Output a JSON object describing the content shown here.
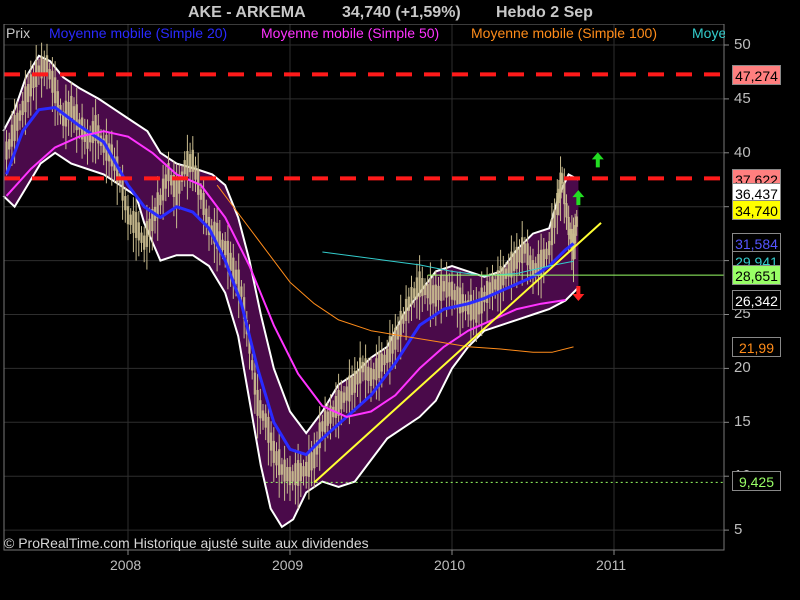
{
  "header": {
    "symbol": "AKE - ARKEMA",
    "price_change": "34,740 (+1,59%)",
    "period": "Hebdo  2 Sep"
  },
  "legend": {
    "items": [
      {
        "label": "Prix",
        "color": "#c8c8c8"
      },
      {
        "label": "Moyenne mobile (Simple 20)",
        "color": "#2a2aff"
      },
      {
        "label": "Moyenne mobile (Simple 50)",
        "color": "#ff33ff"
      },
      {
        "label": "Moyenne mobile (Simple 100)",
        "color": "#ff8c1a"
      },
      {
        "label": "Moye",
        "color": "#33cccc"
      }
    ]
  },
  "copyright": "© ProRealTime.com Historique ajusté suite aux dividendes",
  "axes": {
    "y_ticks": [
      "50",
      "45",
      "40",
      "35",
      "30",
      "25",
      "20",
      "15",
      "10",
      "5"
    ],
    "x_ticks": [
      "2008",
      "2009",
      "2010",
      "2011"
    ]
  },
  "price_tags": [
    {
      "label": "47,274",
      "bg": "#ff7f7f",
      "fg": "#000000",
      "value": 47.274
    },
    {
      "label": "37,622",
      "bg": "#ff7f7f",
      "fg": "#000000",
      "value": 37.622
    },
    {
      "label": "36,437",
      "bg": "#ffffff",
      "fg": "#000000",
      "value": 36.437
    },
    {
      "label": "34,740",
      "bg": "#ffff00",
      "fg": "#000000",
      "value": 34.74
    },
    {
      "label": "31,584",
      "bg": "#000000",
      "fg": "#5555ff",
      "value": 31.584
    },
    {
      "label": "29,941",
      "bg": "#000000",
      "fg": "#33cccc",
      "value": 29.941
    },
    {
      "label": "28,651",
      "bg": "#99ff66",
      "fg": "#000000",
      "value": 28.651
    },
    {
      "label": "26,342",
      "bg": "#000000",
      "fg": "#ffffff",
      "value": 26.342
    },
    {
      "label": "21,99",
      "bg": "#000000",
      "fg": "#ff8c1a",
      "value": 21.99
    },
    {
      "label": "9,425",
      "bg": "#000000",
      "fg": "#99ff66",
      "value": 9.425
    }
  ],
  "colors": {
    "background": "#000000",
    "band_fill": "#4a0a4a",
    "band_edge": "#ffffff",
    "candles": "#c9bc8f",
    "ma20": "#2a2aff",
    "ma50": "#ff33ff",
    "ma100": "#ff8c1a",
    "ma200": "#33cccc",
    "resistance": "#ff1a1a",
    "trendline": "#ffff33",
    "support_green": "#99ff66",
    "arrow_up": "#22dd22",
    "arrow_down": "#ff2222"
  },
  "chart_data": {
    "type": "line",
    "title": "AKE - ARKEMA",
    "ylim": [
      4,
      51
    ],
    "xlim": [
      2007.23,
      2011.62
    ],
    "y_ticks": [
      5,
      10,
      15,
      20,
      25,
      30,
      35,
      40,
      45,
      50
    ],
    "x_ticks": [
      2008,
      2009,
      2010,
      2011
    ],
    "grid": true,
    "series": [
      {
        "name": "Prix",
        "style": "candles",
        "points": [
          [
            2007.25,
            40
          ],
          [
            2007.3,
            42
          ],
          [
            2007.35,
            44
          ],
          [
            2007.4,
            46
          ],
          [
            2007.45,
            47.5
          ],
          [
            2007.5,
            48
          ],
          [
            2007.55,
            45.5
          ],
          [
            2007.6,
            43
          ],
          [
            2007.65,
            44
          ],
          [
            2007.7,
            42.5
          ],
          [
            2007.75,
            41
          ],
          [
            2007.8,
            42
          ],
          [
            2007.85,
            40.5
          ],
          [
            2007.9,
            39.5
          ],
          [
            2007.95,
            37.5
          ],
          [
            2008.0,
            34
          ],
          [
            2008.05,
            33
          ],
          [
            2008.1,
            31.5
          ],
          [
            2008.15,
            33.5
          ],
          [
            2008.2,
            35.5
          ],
          [
            2008.25,
            38
          ],
          [
            2008.3,
            36
          ],
          [
            2008.35,
            38.5
          ],
          [
            2008.4,
            39
          ],
          [
            2008.45,
            36
          ],
          [
            2008.5,
            33
          ],
          [
            2008.55,
            32
          ],
          [
            2008.6,
            31
          ],
          [
            2008.65,
            29
          ],
          [
            2008.7,
            27
          ],
          [
            2008.75,
            22
          ],
          [
            2008.8,
            16.5
          ],
          [
            2008.85,
            15
          ],
          [
            2008.9,
            12
          ],
          [
            2008.95,
            10.5
          ],
          [
            2009.0,
            9.8
          ],
          [
            2009.05,
            10
          ],
          [
            2009.1,
            10.5
          ],
          [
            2009.15,
            11.5
          ],
          [
            2009.2,
            14.5
          ],
          [
            2009.25,
            15.5
          ],
          [
            2009.3,
            16.5
          ],
          [
            2009.35,
            17.5
          ],
          [
            2009.4,
            18.5
          ],
          [
            2009.45,
            20
          ],
          [
            2009.5,
            19
          ],
          [
            2009.55,
            20
          ],
          [
            2009.6,
            21
          ],
          [
            2009.65,
            22.5
          ],
          [
            2009.7,
            24.5
          ],
          [
            2009.75,
            26.5
          ],
          [
            2009.8,
            27.5
          ],
          [
            2009.85,
            27
          ],
          [
            2009.9,
            26.5
          ],
          [
            2009.95,
            27.5
          ],
          [
            2010.0,
            27
          ],
          [
            2010.05,
            26
          ],
          [
            2010.1,
            25.5
          ],
          [
            2010.15,
            25
          ],
          [
            2010.2,
            26.5
          ],
          [
            2010.25,
            27.5
          ],
          [
            2010.3,
            28
          ],
          [
            2010.35,
            29
          ],
          [
            2010.4,
            30
          ],
          [
            2010.45,
            31
          ],
          [
            2010.5,
            29
          ],
          [
            2010.55,
            29.5
          ],
          [
            2010.6,
            31
          ],
          [
            2010.65,
            35
          ],
          [
            2010.68,
            37.5
          ],
          [
            2010.72,
            33
          ],
          [
            2010.75,
            31
          ],
          [
            2010.78,
            34.74
          ]
        ]
      },
      {
        "name": "Moyenne mobile (Simple 20)",
        "points": [
          [
            2007.25,
            38
          ],
          [
            2007.35,
            42
          ],
          [
            2007.45,
            44
          ],
          [
            2007.55,
            44.2
          ],
          [
            2007.7,
            42.5
          ],
          [
            2007.85,
            41
          ],
          [
            2008.0,
            37
          ],
          [
            2008.1,
            35
          ],
          [
            2008.2,
            34
          ],
          [
            2008.3,
            35
          ],
          [
            2008.4,
            34.5
          ],
          [
            2008.5,
            33
          ],
          [
            2008.6,
            30
          ],
          [
            2008.7,
            26
          ],
          [
            2008.8,
            20
          ],
          [
            2008.9,
            15
          ],
          [
            2009.0,
            12.5
          ],
          [
            2009.1,
            12
          ],
          [
            2009.2,
            13.5
          ],
          [
            2009.35,
            15.5
          ],
          [
            2009.5,
            17.5
          ],
          [
            2009.65,
            20.5
          ],
          [
            2009.8,
            24
          ],
          [
            2009.95,
            25.5
          ],
          [
            2010.1,
            26
          ],
          [
            2010.2,
            26.5
          ],
          [
            2010.35,
            27.5
          ],
          [
            2010.5,
            28.5
          ],
          [
            2010.6,
            29.5
          ],
          [
            2010.7,
            31
          ],
          [
            2010.75,
            31.584
          ]
        ]
      },
      {
        "name": "Moyenne mobile (Simple 50)",
        "points": [
          [
            2007.25,
            36
          ],
          [
            2007.4,
            38.5
          ],
          [
            2007.55,
            40.5
          ],
          [
            2007.7,
            41.5
          ],
          [
            2007.85,
            42
          ],
          [
            2008.0,
            41.5
          ],
          [
            2008.15,
            40
          ],
          [
            2008.3,
            38
          ],
          [
            2008.45,
            37
          ],
          [
            2008.6,
            34
          ],
          [
            2008.75,
            29.5
          ],
          [
            2008.9,
            24
          ],
          [
            2009.05,
            19.5
          ],
          [
            2009.2,
            16.5
          ],
          [
            2009.35,
            15.5
          ],
          [
            2009.5,
            16
          ],
          [
            2009.65,
            17.5
          ],
          [
            2009.8,
            20
          ],
          [
            2009.95,
            22
          ],
          [
            2010.1,
            23.5
          ],
          [
            2010.25,
            24.5
          ],
          [
            2010.4,
            25.5
          ],
          [
            2010.55,
            26
          ],
          [
            2010.7,
            26.342
          ]
        ]
      },
      {
        "name": "Moyenne mobile (Simple 100)",
        "points": [
          [
            2008.55,
            37
          ],
          [
            2008.7,
            34
          ],
          [
            2008.85,
            31
          ],
          [
            2009.0,
            28
          ],
          [
            2009.15,
            26
          ],
          [
            2009.3,
            24.5
          ],
          [
            2009.5,
            23.5
          ],
          [
            2009.7,
            23
          ],
          [
            2009.9,
            22.5
          ],
          [
            2010.1,
            22
          ],
          [
            2010.3,
            21.8
          ],
          [
            2010.5,
            21.5
          ],
          [
            2010.62,
            21.5
          ],
          [
            2010.75,
            21.99
          ]
        ]
      },
      {
        "name": "Moye",
        "points": [
          [
            2009.2,
            30.8
          ],
          [
            2009.4,
            30.4
          ],
          [
            2009.6,
            30
          ],
          [
            2009.8,
            29.6
          ],
          [
            2010.0,
            29
          ],
          [
            2010.2,
            28.6
          ],
          [
            2010.4,
            28.8
          ],
          [
            2010.6,
            29.5
          ],
          [
            2010.75,
            29.941
          ]
        ]
      }
    ],
    "bollinger_band": {
      "upper": [
        [
          2007.23,
          42
        ],
        [
          2007.3,
          44
        ],
        [
          2007.37,
          47
        ],
        [
          2007.45,
          49
        ],
        [
          2007.52,
          48.5
        ],
        [
          2007.6,
          47
        ],
        [
          2007.7,
          46
        ],
        [
          2007.82,
          45
        ],
        [
          2007.92,
          44
        ],
        [
          2008.02,
          43
        ],
        [
          2008.12,
          42
        ],
        [
          2008.2,
          40
        ],
        [
          2008.3,
          39
        ],
        [
          2008.42,
          38.5
        ],
        [
          2008.52,
          38
        ],
        [
          2008.6,
          37
        ],
        [
          2008.68,
          34
        ],
        [
          2008.75,
          30
        ],
        [
          2008.82,
          25
        ],
        [
          2008.9,
          20
        ],
        [
          2009.0,
          16
        ],
        [
          2009.1,
          14
        ],
        [
          2009.2,
          16
        ],
        [
          2009.3,
          18.5
        ],
        [
          2009.4,
          19.5
        ],
        [
          2009.5,
          21
        ],
        [
          2009.6,
          22
        ],
        [
          2009.7,
          25
        ],
        [
          2009.8,
          27
        ],
        [
          2009.9,
          29
        ],
        [
          2010.0,
          29.5
        ],
        [
          2010.1,
          29
        ],
        [
          2010.2,
          28.5
        ],
        [
          2010.3,
          29
        ],
        [
          2010.4,
          31
        ],
        [
          2010.5,
          32.5
        ],
        [
          2010.6,
          33
        ],
        [
          2010.66,
          36
        ],
        [
          2010.72,
          38
        ],
        [
          2010.78,
          37.5
        ]
      ],
      "lower": [
        [
          2007.23,
          36
        ],
        [
          2007.3,
          35
        ],
        [
          2007.38,
          37
        ],
        [
          2007.46,
          39
        ],
        [
          2007.55,
          40
        ],
        [
          2007.65,
          39
        ],
        [
          2007.75,
          38.5
        ],
        [
          2007.85,
          38
        ],
        [
          2007.95,
          37
        ],
        [
          2008.05,
          36
        ],
        [
          2008.1,
          33.5
        ],
        [
          2008.2,
          30
        ],
        [
          2008.3,
          30.5
        ],
        [
          2008.4,
          30.5
        ],
        [
          2008.5,
          29.5
        ],
        [
          2008.6,
          27
        ],
        [
          2008.68,
          23
        ],
        [
          2008.75,
          17
        ],
        [
          2008.82,
          11
        ],
        [
          2008.88,
          7
        ],
        [
          2008.95,
          5.3
        ],
        [
          2009.02,
          6
        ],
        [
          2009.1,
          8.5
        ],
        [
          2009.2,
          9.5
        ],
        [
          2009.3,
          9
        ],
        [
          2009.4,
          9.5
        ],
        [
          2009.5,
          11.5
        ],
        [
          2009.6,
          13.5
        ],
        [
          2009.7,
          14.5
        ],
        [
          2009.8,
          15.5
        ],
        [
          2009.9,
          17
        ],
        [
          2010.0,
          20
        ],
        [
          2010.1,
          22
        ],
        [
          2010.2,
          23.5
        ],
        [
          2010.3,
          24
        ],
        [
          2010.4,
          24.5
        ],
        [
          2010.5,
          25
        ],
        [
          2010.6,
          25.5
        ],
        [
          2010.7,
          26.3
        ],
        [
          2010.78,
          27.5
        ]
      ]
    },
    "horizontal_lines": [
      {
        "value": 47.274,
        "style": "dashed",
        "color": "#ff1a1a",
        "x_from": 2007.23
      },
      {
        "value": 37.622,
        "style": "dashed",
        "color": "#ff1a1a",
        "x_from": 2007.23
      },
      {
        "value": 28.651,
        "style": "solid",
        "color": "#99ff66",
        "x_from": 2009.85
      },
      {
        "value": 9.425,
        "style": "dotted",
        "color": "#99ff66",
        "x_from": 2008.85
      }
    ],
    "trendline": {
      "from": [
        2009.15,
        9.425
      ],
      "to": [
        2010.92,
        33.5
      ],
      "color": "#ffff33"
    },
    "markers": [
      {
        "type": "arrow-up",
        "x": 2010.9,
        "y": 39.3,
        "color": "#22dd22"
      },
      {
        "type": "arrow-up",
        "x": 2010.78,
        "y": 35.8,
        "color": "#22dd22"
      },
      {
        "type": "arrow-down",
        "x": 2010.78,
        "y": 27.0,
        "color": "#ff2222"
      }
    ]
  }
}
